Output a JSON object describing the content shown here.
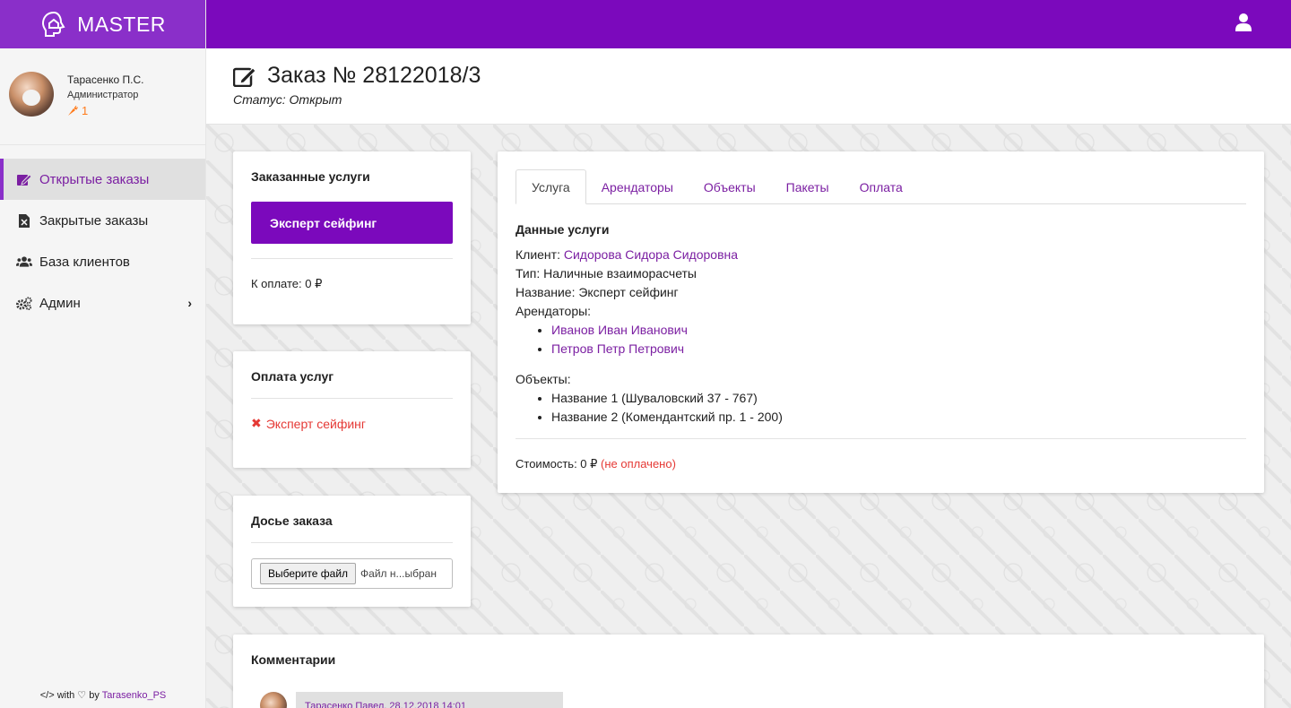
{
  "brand": {
    "name": "MASTER"
  },
  "profile": {
    "name": "Тарасенко П.С.",
    "role": "Администратор",
    "karma": "1"
  },
  "nav": {
    "items": [
      {
        "label": "Открытые заказы",
        "icon": "edit-icon"
      },
      {
        "label": "Закрытые заказы",
        "icon": "file-excel-icon"
      },
      {
        "label": "База клиентов",
        "icon": "users-icon"
      },
      {
        "label": "Админ",
        "icon": "cogs-icon"
      }
    ]
  },
  "footer": {
    "prefix": "</> with ♡ by",
    "author": "Tarasenko_PS"
  },
  "page": {
    "title": "Заказ № 28122018/3",
    "status": "Статус: Открыт"
  },
  "services_card": {
    "title": "Заказанные услуги",
    "service_button": "Эксперт сейфинг",
    "to_pay": "К оплате: 0 ₽"
  },
  "payments_card": {
    "title": "Оплата услуг",
    "unpaid_item": "Эксперт сейфинг"
  },
  "dossier_card": {
    "title": "Досье заказа",
    "file_button": "Выберите файл",
    "file_name": "Файл н...ыбран"
  },
  "comments_card": {
    "title": "Комментарии",
    "first_comment_header": "Тарасенко Павел, 28.12.2018 14:01"
  },
  "tabs": [
    {
      "label": "Услуга"
    },
    {
      "label": "Арендаторы"
    },
    {
      "label": "Объекты"
    },
    {
      "label": "Пакеты"
    },
    {
      "label": "Оплата"
    }
  ],
  "service_details": {
    "title": "Данные услуги",
    "client_label": "Клиент: ",
    "client_name": "Сидорова Сидора Сидоровна",
    "type": "Тип: Наличные взаиморасчеты",
    "name": "Название: Эксперт сейфинг",
    "tenants_label": "Арендаторы:",
    "tenants": [
      "Иванов Иван Иванович",
      "Петров Петр Петрович"
    ],
    "objects_label": "Объекты:",
    "objects": [
      "Название 1 (Шуваловский 37 - 767)",
      "Название 2 (Комендантский пр. 1 - 200)"
    ],
    "cost_label": "Стоимость: 0 ₽ ",
    "cost_status": "(не оплачено)"
  },
  "colors": {
    "accent": "#7b09bc",
    "brand_bg": "#8a2fc9",
    "link": "#7b1fa2",
    "danger": "#e53935",
    "karma": "#ff7a1a"
  }
}
